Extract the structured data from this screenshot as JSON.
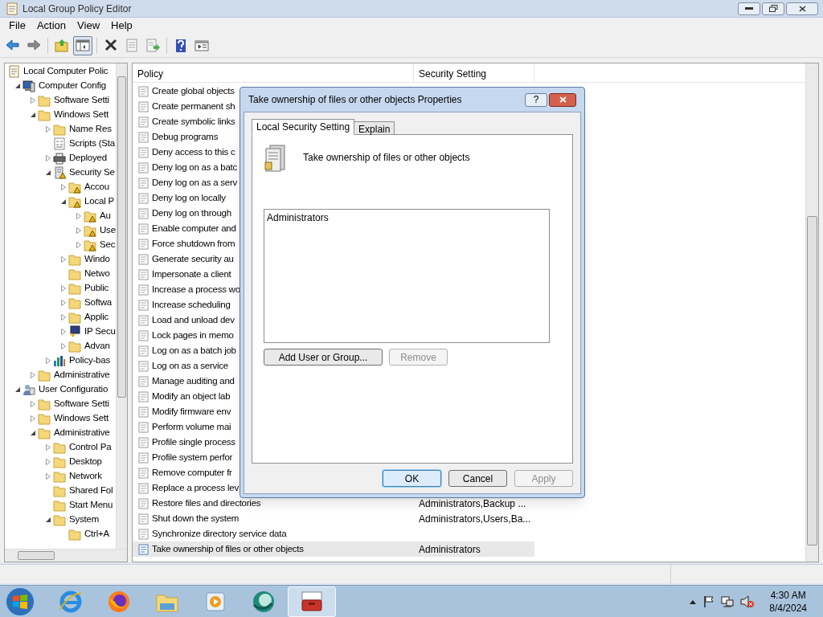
{
  "window": {
    "title": "Local Group Policy Editor"
  },
  "menu": [
    "File",
    "Action",
    "View",
    "Help"
  ],
  "toolbar": [
    {
      "kind": "back"
    },
    {
      "kind": "forward"
    },
    {
      "kind": "up"
    },
    {
      "kind": "tree",
      "selected": true
    },
    {
      "kind": "delete"
    },
    {
      "kind": "properties"
    },
    {
      "kind": "export"
    },
    {
      "kind": "help"
    },
    {
      "kind": "view"
    }
  ],
  "tree": [
    {
      "label": "Local Computer Polic",
      "kind": "doc",
      "children": [
        {
          "label": "Computer Config",
          "kind": "computer",
          "expanded": true,
          "children": [
            {
              "label": "Software Setti",
              "kind": "folder",
              "expanded": false
            },
            {
              "label": "Windows Sett",
              "kind": "folder",
              "expanded": true,
              "children": [
                {
                  "label": "Name Res",
                  "kind": "folder",
                  "expanded": false
                },
                {
                  "label": "Scripts (Sta",
                  "kind": "script"
                },
                {
                  "label": "Deployed",
                  "kind": "printer",
                  "expanded": false
                },
                {
                  "label": "Security Se",
                  "kind": "security",
                  "expanded": true,
                  "children": [
                    {
                      "label": "Accou",
                      "kind": "lockfolder",
                      "expanded": false
                    },
                    {
                      "label": "Local P",
                      "kind": "lockfolder",
                      "expanded": true,
                      "children": [
                        {
                          "label": "Au",
                          "kind": "lockfolder",
                          "expanded": false
                        },
                        {
                          "label": "Use",
                          "kind": "lockfolder",
                          "expanded": false
                        },
                        {
                          "label": "Sec",
                          "kind": "lockfolder",
                          "expanded": false
                        }
                      ]
                    },
                    {
                      "label": "Windo",
                      "kind": "folder",
                      "expanded": false
                    },
                    {
                      "label": "Netwo",
                      "kind": "folder"
                    },
                    {
                      "label": "Public",
                      "kind": "folder",
                      "expanded": false
                    },
                    {
                      "label": "Softwa",
                      "kind": "folder",
                      "expanded": false
                    },
                    {
                      "label": "Applic",
                      "kind": "folder",
                      "expanded": false
                    },
                    {
                      "label": "IP Secu",
                      "kind": "ipsec",
                      "expanded": false
                    },
                    {
                      "label": "Advan",
                      "kind": "folder",
                      "expanded": false
                    }
                  ]
                },
                {
                  "label": "Policy-bas",
                  "kind": "chart",
                  "expanded": false
                }
              ]
            },
            {
              "label": "Administrative",
              "kind": "folder",
              "expanded": false
            }
          ]
        },
        {
          "label": "User Configuratio",
          "kind": "user",
          "expanded": true,
          "children": [
            {
              "label": "Software Setti",
              "kind": "folder",
              "expanded": false
            },
            {
              "label": "Windows Sett",
              "kind": "folder",
              "expanded": false
            },
            {
              "label": "Administrative",
              "kind": "folder",
              "expanded": true,
              "children": [
                {
                  "label": "Control Pa",
                  "kind": "folder",
                  "expanded": false
                },
                {
                  "label": "Desktop",
                  "kind": "folder",
                  "expanded": false
                },
                {
                  "label": "Network",
                  "kind": "folder",
                  "expanded": false
                },
                {
                  "label": "Shared Fol",
                  "kind": "folder"
                },
                {
                  "label": "Start Menu",
                  "kind": "folder"
                },
                {
                  "label": "System",
                  "kind": "folder",
                  "expanded": true,
                  "children": [
                    {
                      "label": "Ctrl+A",
                      "kind": "folder"
                    }
                  ]
                }
              ]
            }
          ]
        }
      ]
    }
  ],
  "table": {
    "columns": [
      "Policy",
      "Security Setting"
    ],
    "rows": [
      {
        "policy": "Create global objects",
        "selected": false
      },
      {
        "policy": "Create permanent sh",
        "selected": false
      },
      {
        "policy": "Create symbolic links",
        "selected": false
      },
      {
        "policy": "Debug programs",
        "selected": false
      },
      {
        "policy": "Deny access to this c",
        "selected": false
      },
      {
        "policy": "Deny log on as a batc",
        "selected": false
      },
      {
        "policy": "Deny log on as a serv",
        "selected": false
      },
      {
        "policy": "Deny log on locally",
        "selected": false
      },
      {
        "policy": "Deny log on through",
        "selected": false
      },
      {
        "policy": "Enable computer and",
        "selected": false
      },
      {
        "policy": "Force shutdown from",
        "selected": false
      },
      {
        "policy": "Generate security au",
        "selected": false
      },
      {
        "policy": "Impersonate a client",
        "selected": false
      },
      {
        "policy": "Increase a process wo",
        "selected": false
      },
      {
        "policy": "Increase scheduling",
        "selected": false
      },
      {
        "policy": "Load and unload dev",
        "selected": false
      },
      {
        "policy": "Lock pages in memo",
        "selected": false
      },
      {
        "policy": "Log on as a batch job",
        "selected": false
      },
      {
        "policy": "Log on as a service",
        "selected": false
      },
      {
        "policy": "Manage auditing and",
        "selected": false
      },
      {
        "policy": "Modify an object lab",
        "selected": false
      },
      {
        "policy": "Modify firmware env",
        "selected": false
      },
      {
        "policy": "Perform volume mai",
        "selected": false
      },
      {
        "policy": "Profile single process",
        "selected": false
      },
      {
        "policy": "Profile system perfor",
        "selected": false
      },
      {
        "policy": "Remove computer fr",
        "selected": false
      },
      {
        "policy": "Replace a process lev",
        "selected": false
      },
      {
        "policy": "Restore files and directories",
        "setting": "Administrators,Backup ...",
        "selected": false
      },
      {
        "policy": "Shut down the system",
        "setting": "Administrators,Users,Ba...",
        "selected": false
      },
      {
        "policy": "Synchronize directory service data",
        "selected": false
      },
      {
        "policy": "Take ownership of files or other objects",
        "setting": "Administrators",
        "selected": true
      }
    ]
  },
  "dialog": {
    "title": "Take ownership of files or other objects Properties",
    "help": "?",
    "tabs": [
      {
        "label": "Local Security Setting",
        "selected": true
      },
      {
        "label": "Explain",
        "selected": false
      }
    ],
    "policy_name": "Take ownership of files or other objects",
    "members": [
      "Administrators"
    ],
    "list_buttons": [
      {
        "label": "Add User or Group...",
        "disabled": false
      },
      {
        "label": "Remove",
        "disabled": true
      }
    ],
    "buttons": [
      {
        "label": "OK",
        "disabled": false,
        "default": true
      },
      {
        "label": "Cancel",
        "disabled": false,
        "default": false
      },
      {
        "label": "Apply",
        "disabled": true,
        "default": false
      }
    ]
  },
  "taskbar": {
    "apps": [
      {
        "kind": "ie",
        "selected": false
      },
      {
        "kind": "firefox",
        "selected": false
      },
      {
        "kind": "explorer",
        "selected": false
      },
      {
        "kind": "media",
        "selected": false
      },
      {
        "kind": "green",
        "selected": false
      },
      {
        "kind": "toolbox",
        "selected": true
      }
    ],
    "time": "4:30 AM",
    "date": "8/4/2024"
  }
}
